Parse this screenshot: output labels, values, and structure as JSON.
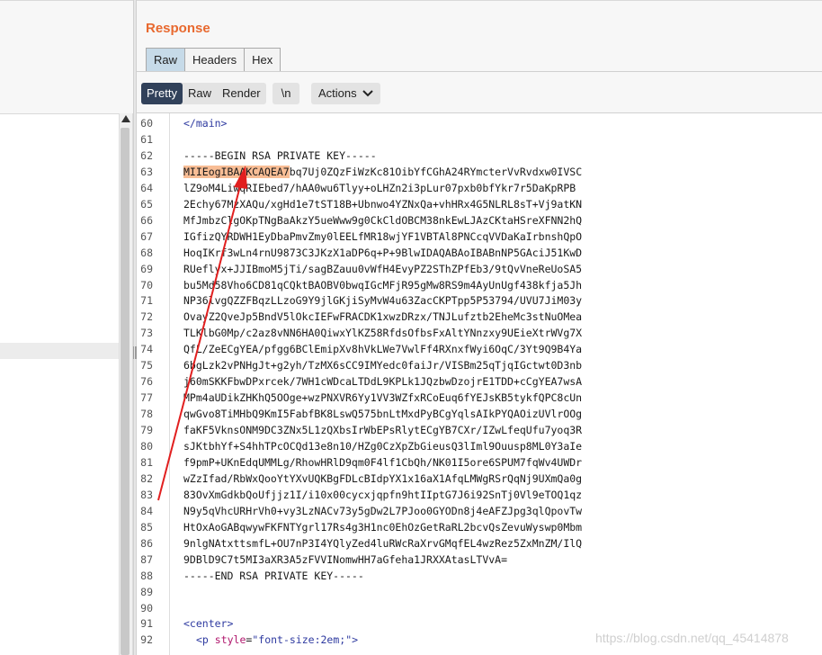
{
  "response": {
    "title": "Response",
    "tabs": [
      "Raw",
      "Headers",
      "Hex"
    ],
    "active_tab": "Raw"
  },
  "toolbar": {
    "view_modes": [
      "Pretty",
      "Raw",
      "Render"
    ],
    "active_mode": "Pretty",
    "newline_label": "\\n",
    "actions_label": "Actions"
  },
  "editor": {
    "lines": [
      {
        "n": "60",
        "text": "</main>"
      },
      {
        "n": "61",
        "text": ""
      },
      {
        "n": "62",
        "text": "-----BEGIN RSA PRIVATE KEY-----"
      },
      {
        "n": "63",
        "highlight": "MIIEogIBAAKCAQEA7",
        "text": "bq7Uj0ZQzFiWzKc81OibYfCGhA24RYmcterVvRvdxw0IVSC"
      },
      {
        "n": "64",
        "text": "lZ9oM4LiwqRIEbed7/hAA0wu6Tlyy+oLHZn2i3pLur07pxb0bfYkr7r5DaKpRPB"
      },
      {
        "n": "65",
        "text": "2Echy67MzXAQu/xgHd1e7tST18B+Ubnwo4YZNxQa+vhHRx4G5NLRL8sT+Vj9atKN"
      },
      {
        "n": "66",
        "text": "MfJmbzClgOKpTNgBaAkzY5ueWww9g0CkCldOBCM38nkEwLJAzCKtaHSreXFNN2hQ"
      },
      {
        "n": "67",
        "text": "IGfizQYRDWH1EyDbaPmvZmy0lEELfMR18wjYF1VBTAl8PNCcqVVDaKaIrbnshQpO"
      },
      {
        "n": "68",
        "text": "HoqIKrf3wLn4rnU9873C3JKzX1aDP6q+P+9BlwIDAQABAoIBABnNP5GAciJ51KwD"
      },
      {
        "n": "69",
        "text": "RUeflyx+JJIBmoM5jTi/sagBZauu0vWfH4EvyPZ2SThZPfEb3/9tQvVneReUoSA5"
      },
      {
        "n": "70",
        "text": "bu5Md58Vho6CD81qCQktBAOBV0bwqIGcMFjR95gMw8RS9m4AyUnUgf438kfja5Jh"
      },
      {
        "n": "71",
        "text": "NP36lvgQZZFBqzLLzoG9Y9jlGKjiSyMvW4u63ZacCKPTpp5P53794/UVU7JiM03y"
      },
      {
        "n": "72",
        "text": "OvayZ2QveJp5BndV5lOkcIEFwFRACDK1xwzDRzx/TNJLufztb2EheMc3stNuOMea"
      },
      {
        "n": "73",
        "text": "TLKlbG0Mp/c2az8vNN6HA0QiwxYlKZ58RfdsOfbsFxAltYNnzxy9UEieXtrWVg7X"
      },
      {
        "n": "74",
        "text": "QfL/ZeECgYEA/pfgg6BClEmipXv8hVkLWe7VwlFf4RXnxfWyi6OqC/3Yt9Q9B4Ya"
      },
      {
        "n": "75",
        "text": "6bgLzk2vPNHgJt+g2yh/TzMX6sCC9IMYedc0faiJr/VISBm25qTjqIGctwt0D3nb"
      },
      {
        "n": "76",
        "text": "j60mSKKFbwDPxrcek/7WH1cWDcaLTDdL9KPLk1JQzbwDzojrE1TDD+cCgYEA7wsA"
      },
      {
        "n": "77",
        "text": "MPm4aUDikZHKhQ5OOge+wzPNXVR6Yy1VV3WZfxRCoEuq6fYEJsKB5tykfQPC8cUn"
      },
      {
        "n": "78",
        "text": "qwGvo8TiMHbQ9KmI5FabfBK8LswQ575bnLtMxdPyBCgYqlsAIkPYQAOizUVlrOOg"
      },
      {
        "n": "79",
        "text": "faKF5VknsONM9DC3ZNx5L1zQXbsIrWbEPsRlytECgYB7CXr/IZwLfeqUfu7yoq3R"
      },
      {
        "n": "80",
        "text": "sJKtbhYf+S4hhTPcOCQd13e8n10/HZg0CzXpZbGieusQ3lIml9Ouusp8ML0Y3aIe"
      },
      {
        "n": "81",
        "text": "f9pmP+UKnEdqUMMLg/RhowHRlD9qm0F4lf1CbQh/NK01I5ore6SPUM7fqWv4UWDr"
      },
      {
        "n": "82",
        "text": "wZzIfad/RbWxQooYtYXvUQKBgFDLcBIdpYX1x16aX1AfqLMWgRSrQqNj9UXmQa0g"
      },
      {
        "n": "83",
        "text": "83OvXmGdkbQoUfjjz1I/i10x00cycxjqpfn9htIIptG7J6i92SnTj0Vl9eTOQ1qz"
      },
      {
        "n": "84",
        "text": "N9y5qVhcURHrVh0+vy3LzNACv73y5gDw2L7PJoo0GYODn8j4eAFZJpg3qlQpovTw"
      },
      {
        "n": "85",
        "text": "HtOxAoGABqwywFKFNTYgrl17Rs4g3H1nc0EhOzGetRaRL2bcvQsZevuWyswp0Mbm"
      },
      {
        "n": "86",
        "text": "9nlgNAtxttsmfL+OU7nP3I4YQlyZed4luRWcRaXrvGMqfEL4wzRez5ZxMnZM/IlQ"
      },
      {
        "n": "87",
        "text": "9DBlD9C7t5MI3aXR3A5zFVVINomwHH7aGfeha1JRXXAtasLTVvA="
      },
      {
        "n": "88",
        "text": "-----END RSA PRIVATE KEY-----"
      },
      {
        "n": "89",
        "text": ""
      },
      {
        "n": "90",
        "text": ""
      },
      {
        "n": "91",
        "tag_text": "<center>"
      },
      {
        "n": "92",
        "tag_open": "<p ",
        "attr": "style",
        "eq": "=",
        "str": "\"font-size:2em;\"",
        "close": ">"
      }
    ]
  },
  "watermark": "https://blog.csdn.net/qq_45414878",
  "colors": {
    "accent": "#e8692f",
    "active_tab": "#c6dae8",
    "active_mode": "#31415a",
    "highlight": "#f8bd95",
    "annotation_arrow": "#e11f1f"
  }
}
